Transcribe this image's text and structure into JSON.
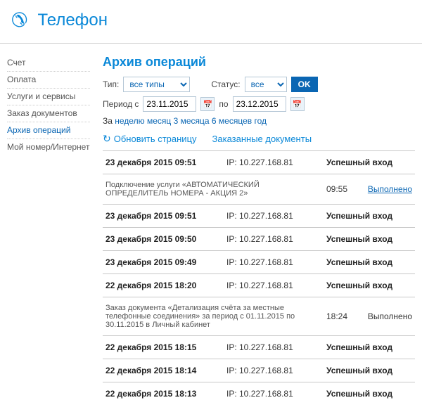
{
  "header": {
    "title": "Телефон"
  },
  "sidebar": {
    "items": [
      {
        "label": "Счет"
      },
      {
        "label": "Оплата"
      },
      {
        "label": "Услуги и сервисы"
      },
      {
        "label": "Заказ документов"
      },
      {
        "label": "Архив операций"
      },
      {
        "label": "Мой номер/Интернет"
      }
    ],
    "active_index": 4
  },
  "filters": {
    "heading": "Архив операций",
    "type_label": "Тип:",
    "type_value": "все типы",
    "status_label": "Статус:",
    "status_value": "все",
    "ok_label": "OK",
    "period_label": "Период с",
    "date_from": "23.11.2015",
    "date_to_label": "по",
    "date_to": "23.12.2015",
    "range_prefix": "За",
    "range_links": [
      "неделю",
      "месяц",
      "3 месяца",
      "6 месяцев",
      "год"
    ],
    "refresh_label": "Обновить страницу",
    "ordered_docs_label": "Заказанные документы"
  },
  "ip_label_prefix": "IP:",
  "operations": [
    {
      "kind": "login",
      "date": "23 декабря 2015 09:51",
      "ip": "10.227.168.81",
      "status": "Успешный вход"
    },
    {
      "kind": "detail",
      "desc": "Подключение услуги «АВТОМАТИЧЕСКИЙ ОПРЕДЕЛИТЕЛЬ НОМЕРА - АКЦИЯ 2»",
      "time": "09:55",
      "result": "Выполнено",
      "result_link": true
    },
    {
      "kind": "login",
      "date": "23 декабря 2015 09:51",
      "ip": "10.227.168.81",
      "status": "Успешный вход"
    },
    {
      "kind": "login",
      "date": "23 декабря 2015 09:50",
      "ip": "10.227.168.81",
      "status": "Успешный вход"
    },
    {
      "kind": "login",
      "date": "23 декабря 2015 09:49",
      "ip": "10.227.168.81",
      "status": "Успешный вход"
    },
    {
      "kind": "login",
      "date": "22 декабря 2015 18:20",
      "ip": "10.227.168.81",
      "status": "Успешный вход"
    },
    {
      "kind": "detail",
      "desc": "Заказ документа «Детализация счёта за местные телефонные соединения» за период с 01.11.2015 по 30.11.2015 в Личный кабинет",
      "time": "18:24",
      "result": "Выполнено",
      "result_link": false
    },
    {
      "kind": "login",
      "date": "22 декабря 2015 18:15",
      "ip": "10.227.168.81",
      "status": "Успешный вход"
    },
    {
      "kind": "login",
      "date": "22 декабря 2015 18:14",
      "ip": "10.227.168.81",
      "status": "Успешный вход"
    },
    {
      "kind": "login",
      "date": "22 декабря 2015 18:13",
      "ip": "10.227.168.81",
      "status": "Успешный вход"
    }
  ]
}
